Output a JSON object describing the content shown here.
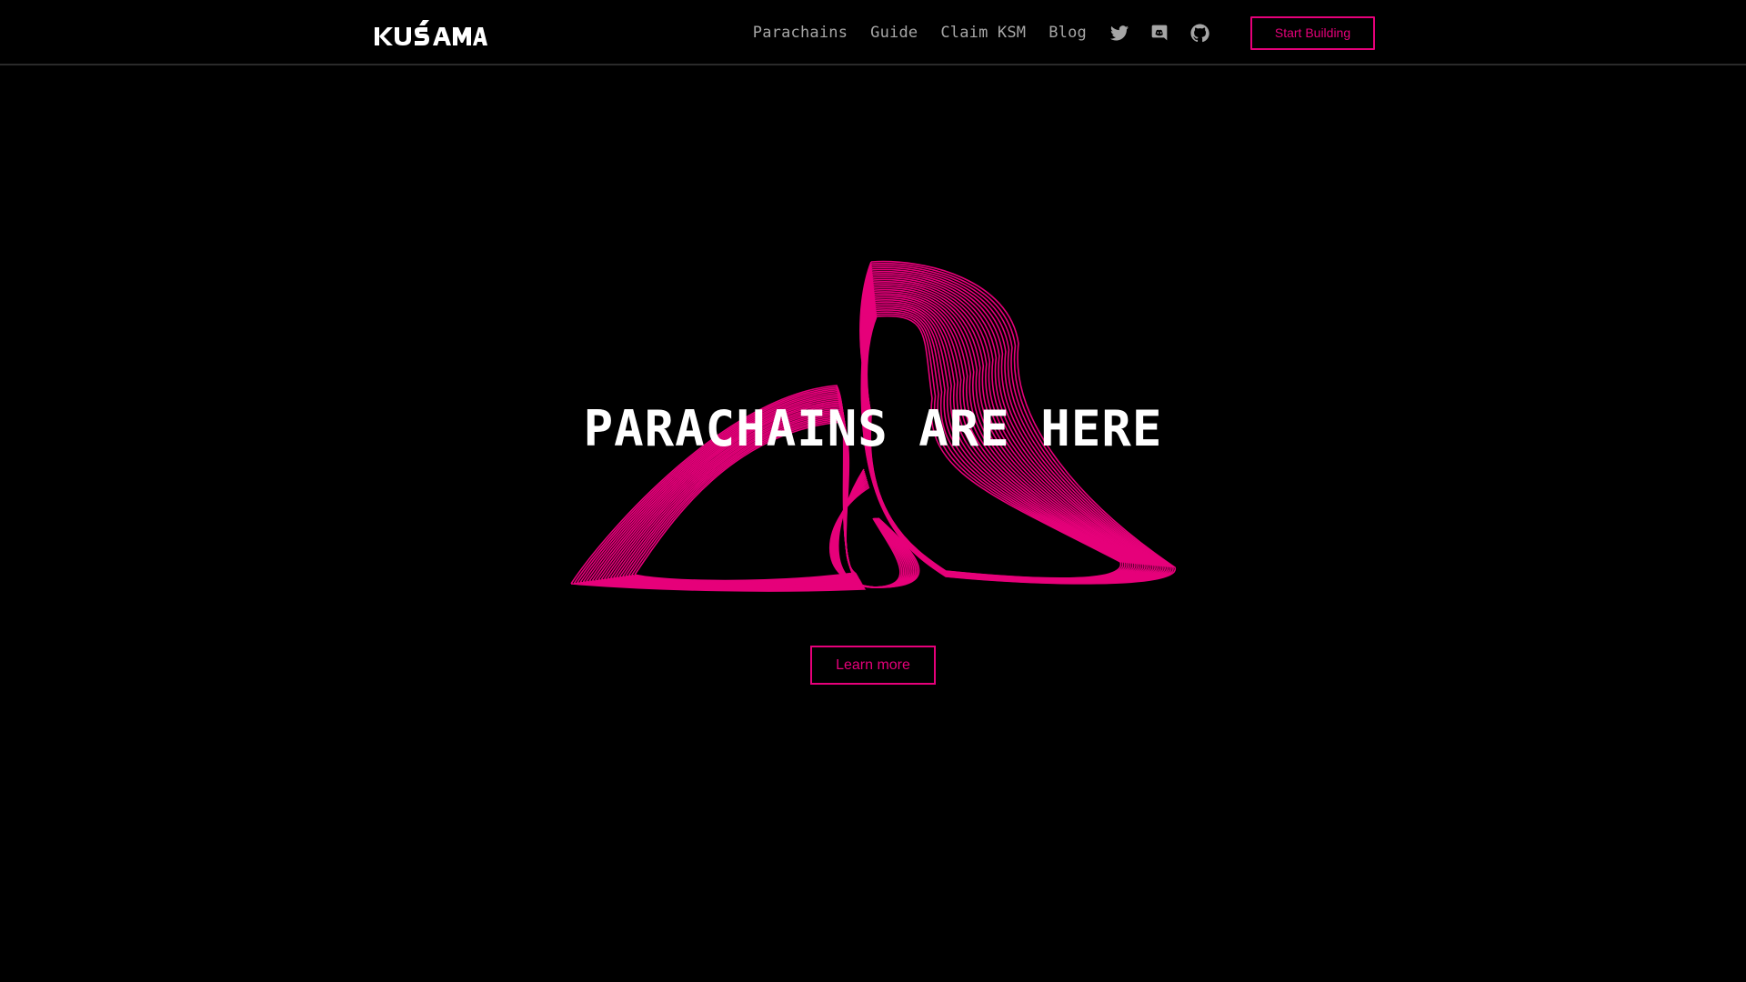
{
  "brand": {
    "logo_text": "KUSAMA",
    "accent_color": "#e6007a",
    "logo_icon": "kusama-wordmark-icon"
  },
  "nav": {
    "links": [
      {
        "label": "Parachains"
      },
      {
        "label": "Guide"
      },
      {
        "label": "Claim KSM"
      },
      {
        "label": "Blog"
      }
    ],
    "social_icons": [
      "twitter-icon",
      "discord-icon",
      "github-icon"
    ],
    "cta_label": "Start Building"
  },
  "hero": {
    "title": "PARACHAINS ARE HERE",
    "button_label": "Learn more",
    "art_icon": "wave-wireframe-illustration"
  }
}
